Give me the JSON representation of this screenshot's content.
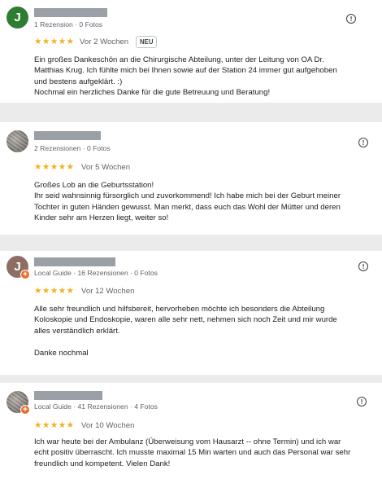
{
  "reviews": [
    {
      "avatar": {
        "letter": "J",
        "color": "#2e7d32"
      },
      "meta": "1 Rezension · 0 Fotos",
      "stars": "★★★★★",
      "age": "Vor 2 Wochen",
      "badge": "NEU",
      "lines": [
        "Ein großes Dankeschön an die Chirurgische Abteilung, unter der Leitung von OA Dr.",
        "Matthias Krug. Ich fühlte mich bei Ihnen sowie auf der Station 24 immer gut aufgehoben",
        "und bestens aufgeklärt. :)",
        "Nochmal ein herzliches Danke für die gute Betreuung und Beratung!"
      ]
    },
    {
      "meta": "2 Rezensionen · 0 Fotos",
      "stars": "★★★★★",
      "age": "Vor 5 Wochen",
      "lines": [
        "Großes Lob an die Geburtsstation!",
        "Ihr seid wahnsinnig fürsorglich und zuvorkommend! Ich habe mich bei der Geburt meiner",
        "Tochter in guten Händen gewusst. Man merkt, dass euch das Wohl der Mütter und deren",
        "Kinder sehr am Herzen liegt, weiter so!"
      ]
    },
    {
      "avatar": {
        "letter": "J",
        "color": "#8d6e63"
      },
      "meta": "Local Guide · 16 Rezensionen · 0 Fotos",
      "stars": "★★★★★",
      "age": "Vor 12 Wochen",
      "lines": [
        "Alle sehr freundlich und hilfsbereit, hervorheben möchte ich besonders die Abteilung",
        "Koloskopie und Endoskopie, waren alle sehr nett, nehmen sich noch Zeit und mir wurde",
        "alles verständlich erklärt.",
        "",
        "Danke nochmal"
      ]
    },
    {
      "meta": "Local Guide · 41 Rezensionen · 4 Fotos",
      "stars": "★★★★★",
      "age": "Vor 10 Wochen",
      "lines": [
        "Ich war heute bei der Ambulanz (Überweisung vom Hausarzt -- ohne Termin) und ich war",
        "echt positiv überrascht. Ich musste maximal 15 Min warten und auch das Personal war sehr",
        "freundlich und kompetent. Vielen Dank!"
      ]
    }
  ],
  "report_glyph": "!",
  "local_guide_badge_glyph": "✦",
  "colors": {
    "star": "#f2b01e",
    "meta": "#5f6368",
    "page_bg": "#ebebeb"
  }
}
